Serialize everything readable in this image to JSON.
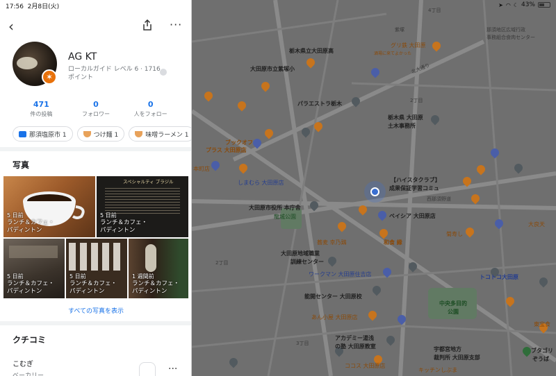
{
  "status": {
    "time": "17:56",
    "date": "2月8日(火)",
    "battery": "43%"
  },
  "profile": {
    "name": "AG KT",
    "level_text": "ローカルガイド レベル 6 · 1716 ポイント",
    "stats": [
      {
        "value": "471",
        "label": "件の投稿"
      },
      {
        "value": "0",
        "label": "フォロワー"
      },
      {
        "value": "0",
        "label": "人をフォロー"
      }
    ],
    "chips": [
      {
        "label": "那須塩原市 1",
        "icon_color": "#1a73e8"
      },
      {
        "label": "つけ麺 1",
        "icon_color": "#e8710a"
      },
      {
        "label": "味噌ラーメン 1",
        "icon_color": "#e8710a"
      }
    ]
  },
  "photos_section": {
    "title": "写真",
    "photos": [
      {
        "when": "5 日前",
        "place": "ランチ＆カフェ・",
        "place2": "パディントン"
      },
      {
        "when": "5 日前",
        "place": "ランチ＆カフェ・",
        "place2": "パディントン",
        "sign": "スペシャルティ ブラジル"
      },
      {
        "when": "5 日前",
        "place": "ランチ＆カフェ・",
        "place2": "パディントン"
      },
      {
        "when": "5 日前",
        "place": "ランチ＆カフェ・",
        "place2": "パディントン"
      },
      {
        "when": "1 週間前",
        "place": "ランチ＆カフェ・",
        "place2": "パディントン"
      }
    ],
    "show_all": "すべての写真を表示"
  },
  "reviews_section": {
    "title": "クチコミ",
    "first": {
      "name": "こむぎ",
      "category": "ベーカリー"
    }
  },
  "map": {
    "labels": [
      {
        "text": "紫塚",
        "style": "lite"
      },
      {
        "text": "グリ鉄 大田原",
        "style": "orange"
      },
      {
        "text": "酒場に来てよかった",
        "style": "orange"
      },
      {
        "text": "那須地区広域行政",
        "style": "lite"
      },
      {
        "text": "事務組合食肉センター",
        "style": "lite"
      },
      {
        "text": "4丁目",
        "style": "lite"
      },
      {
        "text": "栃木県立大田原高",
        "style": "b"
      },
      {
        "text": "北大通り",
        "style": "lite"
      },
      {
        "text": "大田原市立紫塚小",
        "style": "b"
      },
      {
        "text": "2丁目",
        "style": "lite"
      },
      {
        "text": "パラエストラ栃木",
        "style": "b"
      },
      {
        "text": "栃木県 大田原",
        "style": "b"
      },
      {
        "text": "土木事務所",
        "style": "b"
      },
      {
        "text": "ブックオフ",
        "style": "orange"
      },
      {
        "text": "プラス 大田原店",
        "style": "orange"
      },
      {
        "text": "本町店",
        "style": "orange"
      },
      {
        "text": "しまむら 大田原店",
        "style": "blue"
      },
      {
        "text": "【ハイスタクラブ】",
        "style": "b"
      },
      {
        "text": "成果保証学習コミュ",
        "style": "b"
      },
      {
        "text": "西那須野道",
        "style": "lite"
      },
      {
        "text": "大田原市役所 本庁舎",
        "style": "b"
      },
      {
        "text": "ベイシア 大田原店",
        "style": "b"
      },
      {
        "text": "龍城公園",
        "style": "green"
      },
      {
        "text": "大良天",
        "style": "orange"
      },
      {
        "text": "菊寿し",
        "style": "orange"
      },
      {
        "text": "蕎麦 幸乃鶏",
        "style": "orange"
      },
      {
        "text": "和食 縁",
        "style": "orange"
      },
      {
        "text": "大田原地域職業",
        "style": "b"
      },
      {
        "text": "訓練センター",
        "style": "b"
      },
      {
        "text": "2丁目",
        "style": "lite"
      },
      {
        "text": "ワークマン 大田原住吉店",
        "style": "blue"
      },
      {
        "text": "トコトコ大田原",
        "style": "blue"
      },
      {
        "text": "能開センター 大田原校",
        "style": "b"
      },
      {
        "text": "中央多目的",
        "style": "green"
      },
      {
        "text": "公園",
        "style": "green"
      },
      {
        "text": "あん小屋 大田原店",
        "style": "orange"
      },
      {
        "text": "東宝食",
        "style": "orange"
      },
      {
        "text": "アカデミー湯浅",
        "style": "b"
      },
      {
        "text": "の塾 大田原教室",
        "style": "b"
      },
      {
        "text": "3丁目",
        "style": "lite"
      },
      {
        "text": "宇都宮地方",
        "style": "b"
      },
      {
        "text": "裁判所 大田原支部",
        "style": "b"
      },
      {
        "text": "ブタゴリ",
        "style": "b"
      },
      {
        "text": "ぞうば",
        "style": "b"
      },
      {
        "text": "ココス 大田原店",
        "style": "orange"
      },
      {
        "text": "キッチンしぶま",
        "style": "orange"
      }
    ]
  }
}
